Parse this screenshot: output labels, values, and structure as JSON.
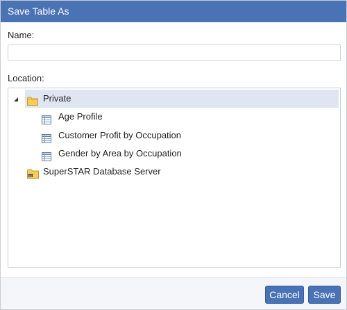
{
  "dialog": {
    "title": "Save Table As",
    "name_label": "Name:",
    "name_value": "",
    "location_label": "Location:"
  },
  "tree": {
    "root": {
      "label": "Private",
      "icon": "folder-icon",
      "expanded": true,
      "selected": true,
      "children": [
        {
          "label": "Age Profile",
          "icon": "table-icon"
        },
        {
          "label": "Customer Profit by Occupation",
          "icon": "table-icon"
        },
        {
          "label": "Gender by Area by Occupation",
          "icon": "table-icon"
        }
      ]
    },
    "server": {
      "label": "SuperSTAR Database Server",
      "icon": "server-folder-icon"
    }
  },
  "buttons": {
    "cancel_label": "Cancel",
    "save_label": "Save"
  },
  "colors": {
    "accent": "#4a73b6",
    "selection": "#dfe6f2",
    "footer_bg": "#f4f6f9",
    "folder": "#f2c34b"
  }
}
